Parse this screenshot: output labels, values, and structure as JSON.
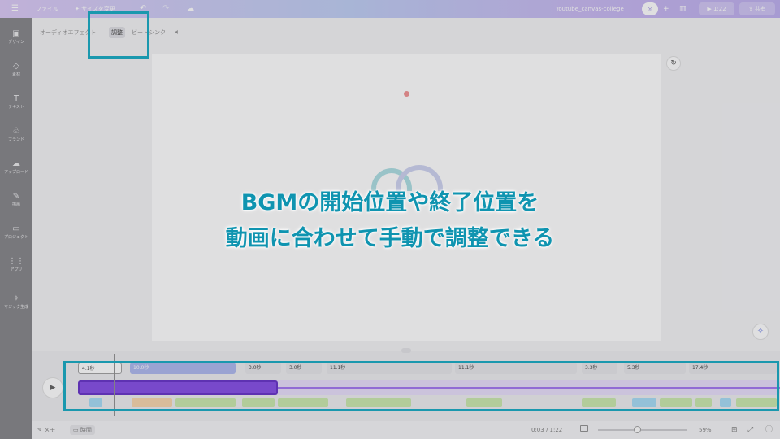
{
  "topbar": {
    "menu_icon": "menu-icon",
    "file_label": "ファイル",
    "resize_label": "サイズを変更",
    "undo_icon": "undo-icon",
    "redo_icon": "redo-icon",
    "cloud_icon": "cloud-saved-icon",
    "doc_title": "Youtube_canvas-college",
    "add_label": "+",
    "analytics_icon": "bar-chart-icon",
    "play_label": "1:22",
    "share_label": "共有"
  },
  "sidebar": {
    "items": [
      {
        "icon": "design-icon",
        "label": "デザイン"
      },
      {
        "icon": "elements-icon",
        "label": "素材"
      },
      {
        "icon": "text-icon",
        "label": "テキスト"
      },
      {
        "icon": "brand-icon",
        "label": "ブランド"
      },
      {
        "icon": "upload-icon",
        "label": "アップロード"
      },
      {
        "icon": "draw-icon",
        "label": "描画"
      },
      {
        "icon": "projects-icon",
        "label": "プロジェクト"
      },
      {
        "icon": "apps-icon",
        "label": "アプリ"
      },
      {
        "icon": "magic-icon",
        "label": "マジック生成"
      }
    ]
  },
  "context_bar": {
    "audio_effects": "オーディオエフェクト",
    "adjust": "調整",
    "beat_sync": "ビートシンク",
    "volume_icon": "volume-icon"
  },
  "caption": {
    "line1": "BGMの開始位置や終了位置を",
    "line2": "動画に合わせて手動で調整できる"
  },
  "timeline": {
    "play_icon": "play-icon",
    "segments": [
      "4.1秒",
      "10.0秒",
      "3.0秒",
      "3.0秒",
      "11.1秒",
      "11.1秒",
      "3.3秒",
      "5.3秒",
      "17.4秒"
    ]
  },
  "bottombar": {
    "notes_label": "メモ",
    "timer_label": "時間",
    "time_readout": "0:03 / 1:22",
    "zoom_label": "59%"
  },
  "colors": {
    "highlight": "#1a98ae",
    "audio_track": "#7b3fe4",
    "caption": "#0f94b0",
    "topbar_gradient_start": "#d8c4f5"
  }
}
